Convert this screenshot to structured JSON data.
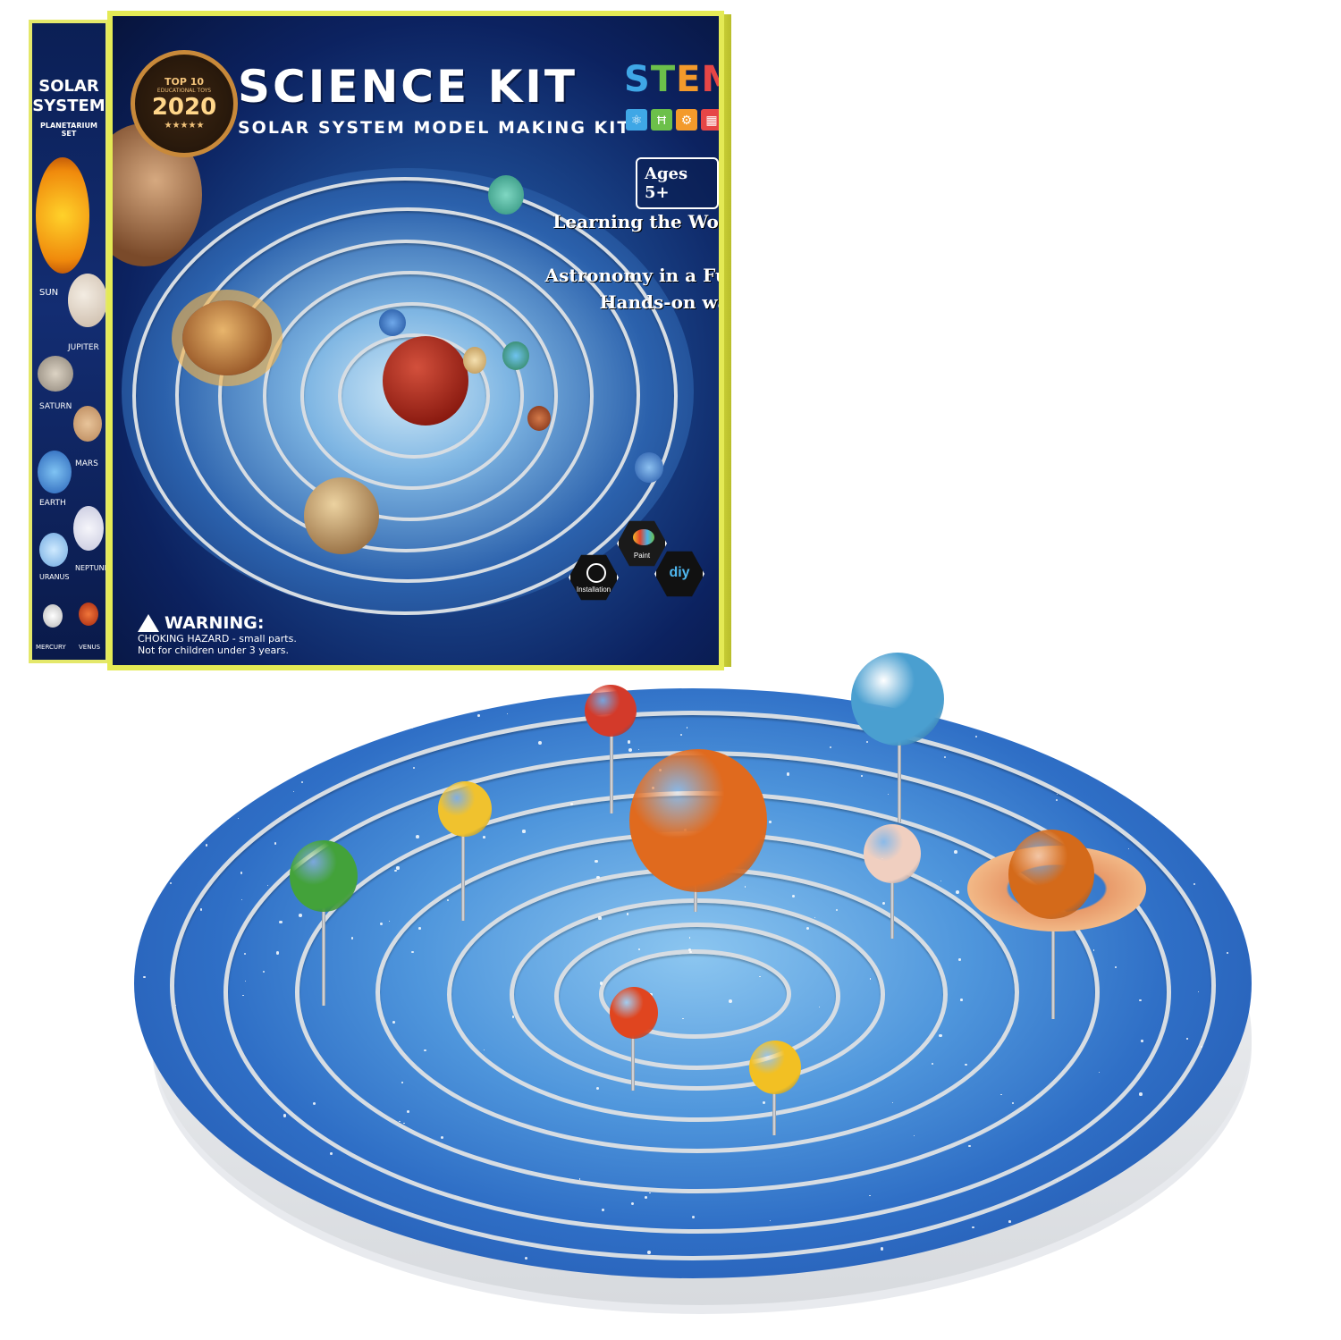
{
  "box": {
    "side": {
      "title_lines": [
        "SOLAR",
        "SYSTEM"
      ],
      "subtitle": "PLANETARIUM SET",
      "planet_labels": [
        "SUN",
        "JUPITER",
        "SATURN",
        "MARS",
        "EARTH",
        "NEPTUNE",
        "URANUS",
        "MERCURY",
        "VENUS"
      ]
    },
    "front": {
      "award": {
        "line1": "TOP 10",
        "line2": "EDUCATIONAL TOYS",
        "year": "2020",
        "stars": "★★★★★"
      },
      "title": "SCIENCE KIT",
      "subtitle": "SOLAR SYSTEM MODEL MAKING KIT",
      "stem_letters": [
        "S",
        "T",
        "E",
        "M"
      ],
      "stem_colors": [
        "#3fa7e6",
        "#6cc04a",
        "#f39a2b",
        "#e64646"
      ],
      "stem_icons": [
        "atom-icon",
        "bridge-icon",
        "gear-icon",
        "calculator-icon"
      ],
      "ages": "Ages 5+",
      "tagline_lines": [
        "Learning the World of",
        "Astronomy in a Fun,",
        "Hands-on way!"
      ],
      "features": [
        "Installation",
        "Paint",
        "diy"
      ],
      "warning": {
        "title": "WARNING:",
        "line1": "CHOKING HAZARD - small parts.",
        "line2": "Not for children under 3 years."
      }
    }
  },
  "model": {
    "planets": [
      {
        "name": "sun",
        "color": "#e06a1e"
      },
      {
        "name": "mercury",
        "color": "#d33a2a"
      },
      {
        "name": "venus",
        "color": "#f0c22e"
      },
      {
        "name": "earth",
        "color": "#4a9fd0"
      },
      {
        "name": "mars",
        "color": "#e0451f"
      },
      {
        "name": "jupiter",
        "color": "#f0cfc0"
      },
      {
        "name": "saturn",
        "color": "#d46a1a"
      },
      {
        "name": "uranus",
        "color": "#43a23a"
      },
      {
        "name": "neptune",
        "color": "#f2c023"
      }
    ]
  }
}
